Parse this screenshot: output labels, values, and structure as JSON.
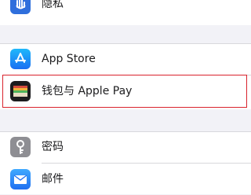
{
  "settings": {
    "items": [
      {
        "id": "privacy",
        "label": "隐私",
        "icon": "privacy-hand-icon",
        "color": "#2f6fdc"
      },
      {
        "id": "app-store",
        "label": "App Store",
        "icon": "app-store-icon",
        "color": "#1a8ff5"
      },
      {
        "id": "wallet",
        "label": "钱包与 Apple Pay",
        "icon": "wallet-icon",
        "color": "#1c1c1e"
      },
      {
        "id": "passwords",
        "label": "密码",
        "icon": "key-icon",
        "color": "#8e8e93"
      },
      {
        "id": "mail",
        "label": "邮件",
        "icon": "mail-icon",
        "color": "#2f7ff0"
      }
    ]
  },
  "highlight_color": "#d9232d"
}
